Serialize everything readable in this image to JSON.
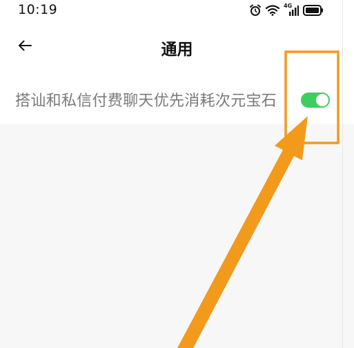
{
  "status_bar": {
    "time": "10:19",
    "network_label": "4G",
    "icons": [
      "alarm-icon",
      "wifi-icon",
      "cellular-signal-icon",
      "battery-icon"
    ]
  },
  "header": {
    "back_icon": "arrow-left-icon",
    "title": "通用"
  },
  "settings": {
    "items": [
      {
        "label": "搭讪和私信付费聊天优先消耗次元宝石",
        "enabled": true
      }
    ]
  },
  "colors": {
    "toggle_on": "#3ccf5e",
    "annotation": "#f29a1c",
    "label_text": "#7a7a7a",
    "background": "#f7f7f7"
  }
}
